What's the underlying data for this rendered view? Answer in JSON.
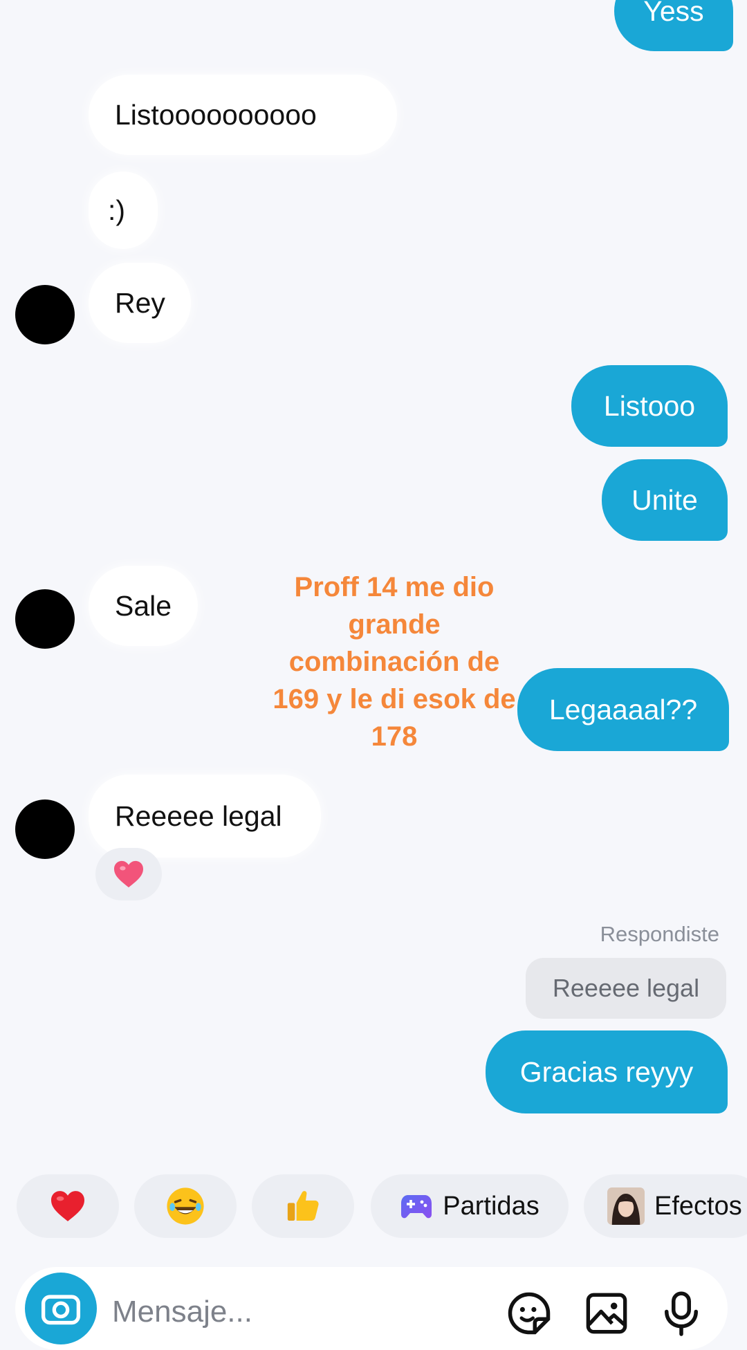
{
  "colors": {
    "outgoing_bubble": "#1aa7d6",
    "incoming_bubble": "#ffffff",
    "overlay_text": "#f5873a",
    "background": "#f6f7fb"
  },
  "messages": {
    "m1": "Yess",
    "m2": "Listoooooooooo",
    "m3": ":)",
    "m4": "Rey",
    "m5": "Listooo",
    "m6": "Unite",
    "m7": "Sale",
    "m8": "Legaaaal??",
    "m9": "Reeeee legal",
    "m9_reaction": "heart",
    "replied_label": "Respondiste",
    "replied_quote": "Reeeee legal",
    "m10": "Gracias reyyy"
  },
  "overlay_caption": "Proff 14 me dio\ngrande\ncombinación de\n169 y le di esok de\n178",
  "quick_replies": {
    "heart": "heart-emoji",
    "laugh": "laughing-emoji",
    "thumbs": "thumbs-up-emoji",
    "partidas": "Partidas",
    "efectos": "Efectos"
  },
  "composer": {
    "placeholder": "Mensaje..."
  }
}
